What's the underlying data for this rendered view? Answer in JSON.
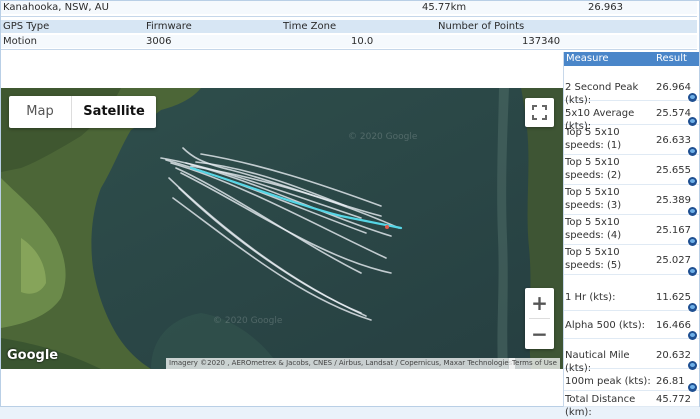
{
  "session": {
    "location": "Kanahooka, NSW, AU",
    "distance": "45.77km",
    "speed": "26.963"
  },
  "table": {
    "headers": [
      "GPS Type",
      "Firmware",
      "Time Zone",
      "Number of Points"
    ],
    "values": [
      "Motion",
      "3006",
      "10.0",
      "137340"
    ]
  },
  "map": {
    "type_map": "Map",
    "type_satellite": "Satellite",
    "zoom_in": "+",
    "zoom_out": "−",
    "logo": "Google",
    "attribution": "Imagery ©2020 , AEROmetrex & Jacobs, CNES / Airbus, Landsat / Copernicus, Maxar Technologies",
    "terms": "Terms of Use",
    "watermark": "© 2020 Google",
    "icons": [
      "fullscreen-icon",
      "plus-icon",
      "minus-icon"
    ],
    "colors": {
      "track": "#e8eef3",
      "highlight": "#56d6e6",
      "water": "#2c4a49",
      "land": "#4d6a37"
    }
  },
  "stats": {
    "header_measure": "Measure",
    "header_result": "Result",
    "rows": [
      {
        "measure": "2 Second Peak (kts):",
        "result": "26.964"
      },
      {
        "measure": "5x10 Average (kts):",
        "result": "25.574"
      },
      {
        "measure": "Top 5 5x10 speeds: (1)",
        "result": "26.633"
      },
      {
        "measure": "Top 5 5x10 speeds: (2)",
        "result": "25.655"
      },
      {
        "measure": "Top 5 5x10 speeds: (3)",
        "result": "25.389"
      },
      {
        "measure": "Top 5 5x10 speeds: (4)",
        "result": "25.167"
      },
      {
        "measure": "Top 5 5x10 speeds: (5)",
        "result": "25.027"
      },
      {
        "measure": "1 Hr (kts):",
        "result": "11.625"
      },
      {
        "measure": "Alpha 500 (kts):",
        "result": "16.466"
      },
      {
        "measure": "Nautical Mile (kts):",
        "result": "20.632"
      },
      {
        "measure": "100m peak (kts):",
        "result": "26.81"
      },
      {
        "measure": "Total Distance (km):",
        "result": "45.772"
      }
    ]
  }
}
